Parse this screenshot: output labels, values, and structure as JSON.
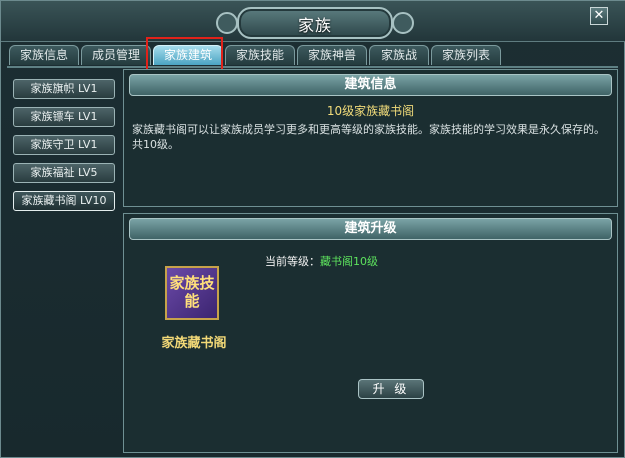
{
  "window": {
    "title": "家族",
    "close_label": "✕"
  },
  "tabs": [
    {
      "label": "家族信息",
      "active": false
    },
    {
      "label": "成员管理",
      "active": false
    },
    {
      "label": "家族建筑",
      "active": true
    },
    {
      "label": "家族技能",
      "active": false
    },
    {
      "label": "家族神兽",
      "active": false
    },
    {
      "label": "家族战",
      "active": false
    },
    {
      "label": "家族列表",
      "active": false
    }
  ],
  "sidebar": {
    "items": [
      {
        "label": "家族旗帜 LV1"
      },
      {
        "label": "家族镖车 LV1"
      },
      {
        "label": "家族守卫 LV1"
      },
      {
        "label": "家族福祉 LV5"
      },
      {
        "label": "家族藏书阁 LV10",
        "active": true
      }
    ]
  },
  "info_panel": {
    "header": "建筑信息",
    "subtitle": "10级家族藏书阁",
    "description": "家族藏书阁可以让家族成员学习更多和更高等级的家族技能。家族技能的学习效果是永久保存的。共10级。"
  },
  "upgrade_panel": {
    "header": "建筑升级",
    "current_level_label": "当前等级：",
    "current_level_value": "藏书阁10级",
    "icon_text": "家族技能",
    "building_name": "家族藏书阁",
    "upgrade_button": "升 级"
  },
  "colors": {
    "accent_tab": "#4ba3c2",
    "highlight_box": "#e0221a",
    "value_green": "#5de25d",
    "gold_text": "#f2d877"
  }
}
